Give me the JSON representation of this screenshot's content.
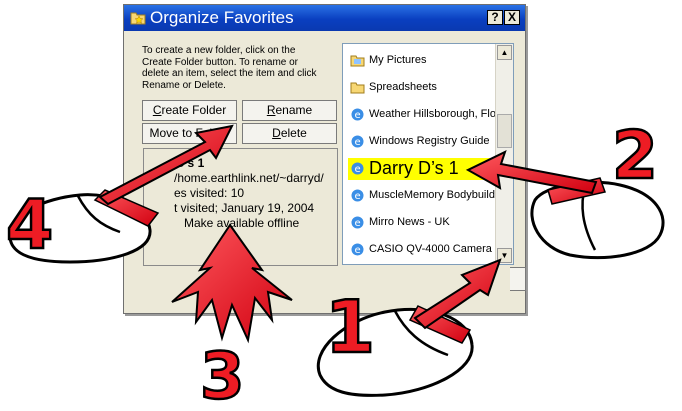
{
  "dialog": {
    "title": "Organize Favorites",
    "help_label": "?",
    "close_label": "X",
    "instructions": "To create a new folder, click on the Create Folder button. To rename or delete an item, select the item and click Rename or Delete.",
    "buttons": {
      "create_folder": "Create Folder",
      "rename": "Rename",
      "move_to_folder": "Move to Folder",
      "delete": "Delete"
    },
    "info": {
      "title": "D’s 1",
      "url": "/home.earthlink.net/~darryd/",
      "visits": "es visited: 10",
      "last_visited": "t visited; January 19, 2004",
      "offline": "Make available offline"
    },
    "list": [
      {
        "label": "My Pictures",
        "icon": "folder-icon"
      },
      {
        "label": "Spreadsheets",
        "icon": "folder-icon"
      },
      {
        "label": "Weather Hillsborough, Flo...",
        "icon": "ie-page-icon"
      },
      {
        "label": "Windows Registry Guide",
        "icon": "ie-page-icon"
      },
      {
        "label": "Darry D’s 1",
        "icon": "ie-page-icon",
        "selected": true
      },
      {
        "label": "MuscleMemory Bodybuildi...",
        "icon": "ie-page-icon"
      },
      {
        "label": "Mirro News - UK",
        "icon": "ie-page-icon"
      },
      {
        "label": "CASIO QV-4000 Camera",
        "icon": "ie-page-icon"
      }
    ]
  },
  "annotations": {
    "step1": "1",
    "step2": "2",
    "step3": "3",
    "step4": "4",
    "step_color": "#ee1c24"
  }
}
